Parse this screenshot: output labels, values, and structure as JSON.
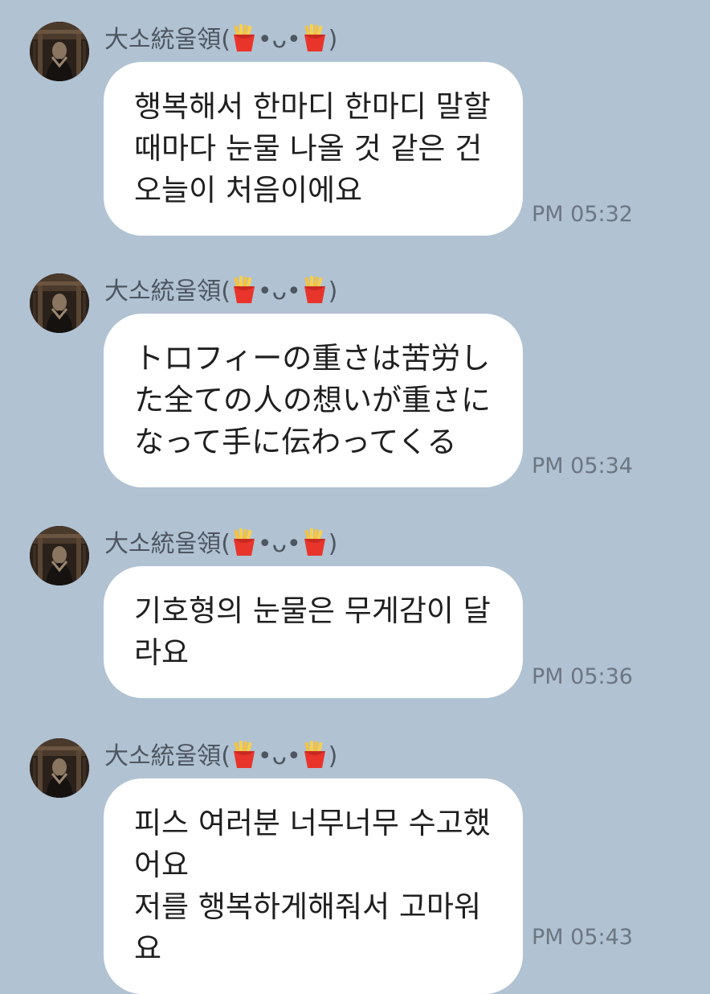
{
  "sender": {
    "name_prefix": "大소統울領(",
    "name_middle": "•ᴗ•",
    "name_suffix": ")"
  },
  "messages": [
    {
      "text": "행복해서 한마디 한마디 말할 때마다 눈물 나올 것 같은 건 오늘이 처음이에요",
      "time": "PM 05:32"
    },
    {
      "text": "トロフィーの重さは苦労した全ての人の想いが重さになって手に伝わってくる",
      "time": "PM 05:34"
    },
    {
      "text": "기호형의 눈물은 무게감이 달라요",
      "time": "PM 05:36"
    },
    {
      "text": "피스 여러분 너무너무 수고했어요\n저를 행복하게해줘서 고마워요",
      "time": "PM 05:43"
    }
  ],
  "colors": {
    "background": "#b1c2d2",
    "bubble": "#ffffff",
    "sender_text": "#4d5661",
    "timestamp_text": "#6c7682"
  },
  "icons": {
    "avatar": "profile-photo",
    "name_emoji": "french-fries-icon"
  }
}
